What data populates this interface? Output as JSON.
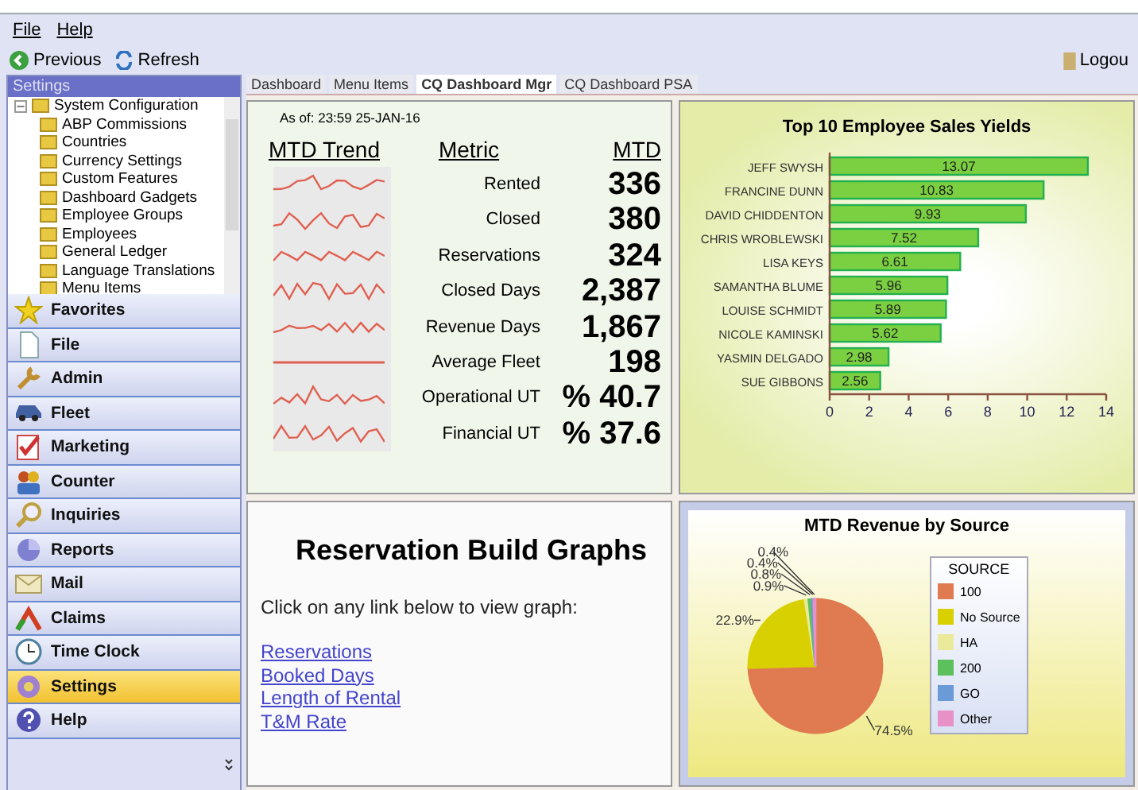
{
  "menu": [
    "File",
    "Help"
  ],
  "toolbar": [
    {
      "label": "Previous",
      "kind": "back"
    },
    {
      "label": "Refresh",
      "kind": "refresh"
    }
  ],
  "logout": "Logou",
  "sidebar": {
    "title": "Settings",
    "tree": [
      {
        "label": "System Configuration",
        "expanded": true,
        "children": [
          {
            "label": "ABP Commissions"
          },
          {
            "label": "Countries"
          },
          {
            "label": "Currency Settings"
          },
          {
            "label": "Custom Features"
          },
          {
            "label": "Dashboard Gadgets"
          },
          {
            "label": "Employee Groups"
          },
          {
            "label": "Employees"
          },
          {
            "label": "General Ledger"
          },
          {
            "label": "Language Translations"
          },
          {
            "label": "Menu Items"
          }
        ]
      }
    ],
    "nav": [
      {
        "label": "Favorites",
        "kind": "star",
        "selected": false
      },
      {
        "label": "File",
        "kind": "page",
        "selected": false
      },
      {
        "label": "Admin",
        "kind": "tools",
        "selected": false
      },
      {
        "label": "Fleet",
        "kind": "car",
        "selected": false
      },
      {
        "label": "Marketing",
        "kind": "check",
        "selected": false
      },
      {
        "label": "Counter",
        "kind": "people",
        "selected": false
      },
      {
        "label": "Inquiries",
        "kind": "magnifier",
        "selected": false
      },
      {
        "label": "Reports",
        "kind": "pie",
        "selected": false
      },
      {
        "label": "Mail",
        "kind": "envelope",
        "selected": false
      },
      {
        "label": "Claims",
        "kind": "arrow",
        "selected": false
      },
      {
        "label": "Time Clock",
        "kind": "clock",
        "selected": false
      },
      {
        "label": "Settings",
        "kind": "gear",
        "selected": true
      },
      {
        "label": "Help",
        "kind": "question",
        "selected": false
      }
    ]
  },
  "tabs": [
    {
      "label": "Dashboard",
      "selected": false
    },
    {
      "label": "Menu Items",
      "selected": false
    },
    {
      "label": "CQ Dashboard Mgr",
      "selected": true
    },
    {
      "label": "CQ Dashboard PSA",
      "selected": false
    }
  ],
  "metrics_panel": {
    "as_of": "As of: 23:59 25-JAN-16",
    "columns": [
      "MTD Trend",
      "Metric",
      "MTD"
    ],
    "rows": [
      {
        "metric": "Rented",
        "mtd": "336"
      },
      {
        "metric": "Closed",
        "mtd": "380"
      },
      {
        "metric": "Reservations",
        "mtd": "324"
      },
      {
        "metric": "Closed Days",
        "mtd": "2,387"
      },
      {
        "metric": "Revenue Days",
        "mtd": "1,867"
      },
      {
        "metric": "Average Fleet",
        "mtd": "198"
      },
      {
        "metric": "Operational UT",
        "mtd": "% 40.7"
      },
      {
        "metric": "Financial UT",
        "mtd": "% 37.6"
      }
    ]
  },
  "sales_panel": {
    "chart_data": {
      "type": "bar",
      "orientation": "horizontal",
      "title": "Top 10 Employee Sales Yields",
      "categories": [
        "JEFF SWYSH",
        "FRANCINE DUNN",
        "DAVID CHIDDENTON",
        "CHRIS WROBLEWSKI",
        "LISA KEYS",
        "SAMANTHA BLUME",
        "LOUISE SCHMIDT",
        "NICOLE KAMINSKI",
        "YASMIN DELGADO",
        "SUE GIBBONS"
      ],
      "values": [
        13.07,
        10.83,
        9.93,
        7.52,
        6.61,
        5.96,
        5.89,
        5.62,
        2.98,
        2.56
      ],
      "xlim": [
        0,
        14
      ],
      "xticks": [
        0,
        2,
        4,
        6,
        8,
        10,
        12,
        14
      ],
      "data_labels": true
    }
  },
  "graphs_panel": {
    "title": "Reservation Build Graphs",
    "intro": "Click on any link below to view graph:",
    "links": [
      "Reservations",
      "Booked Days",
      "Length of Rental",
      "T&M Rate"
    ]
  },
  "revenue_panel": {
    "chart_data": {
      "type": "pie",
      "title": "MTD Revenue by Source",
      "legend": {
        "title": "SOURCE"
      },
      "categories": [
        "100",
        "No Source",
        "HA",
        "200",
        "GO",
        "Other"
      ],
      "values": [
        74.5,
        22.9,
        0.9,
        0.8,
        0.4,
        0.4
      ],
      "colors": [
        "#e07a50",
        "#d8d000",
        "#eaea9a",
        "#5cc05c",
        "#6a9ad8",
        "#e890c8"
      ],
      "value_labels": [
        "74.5%",
        "22.9%",
        "0.9%",
        "0.8%",
        "0.4%",
        "0.4%"
      ]
    }
  }
}
